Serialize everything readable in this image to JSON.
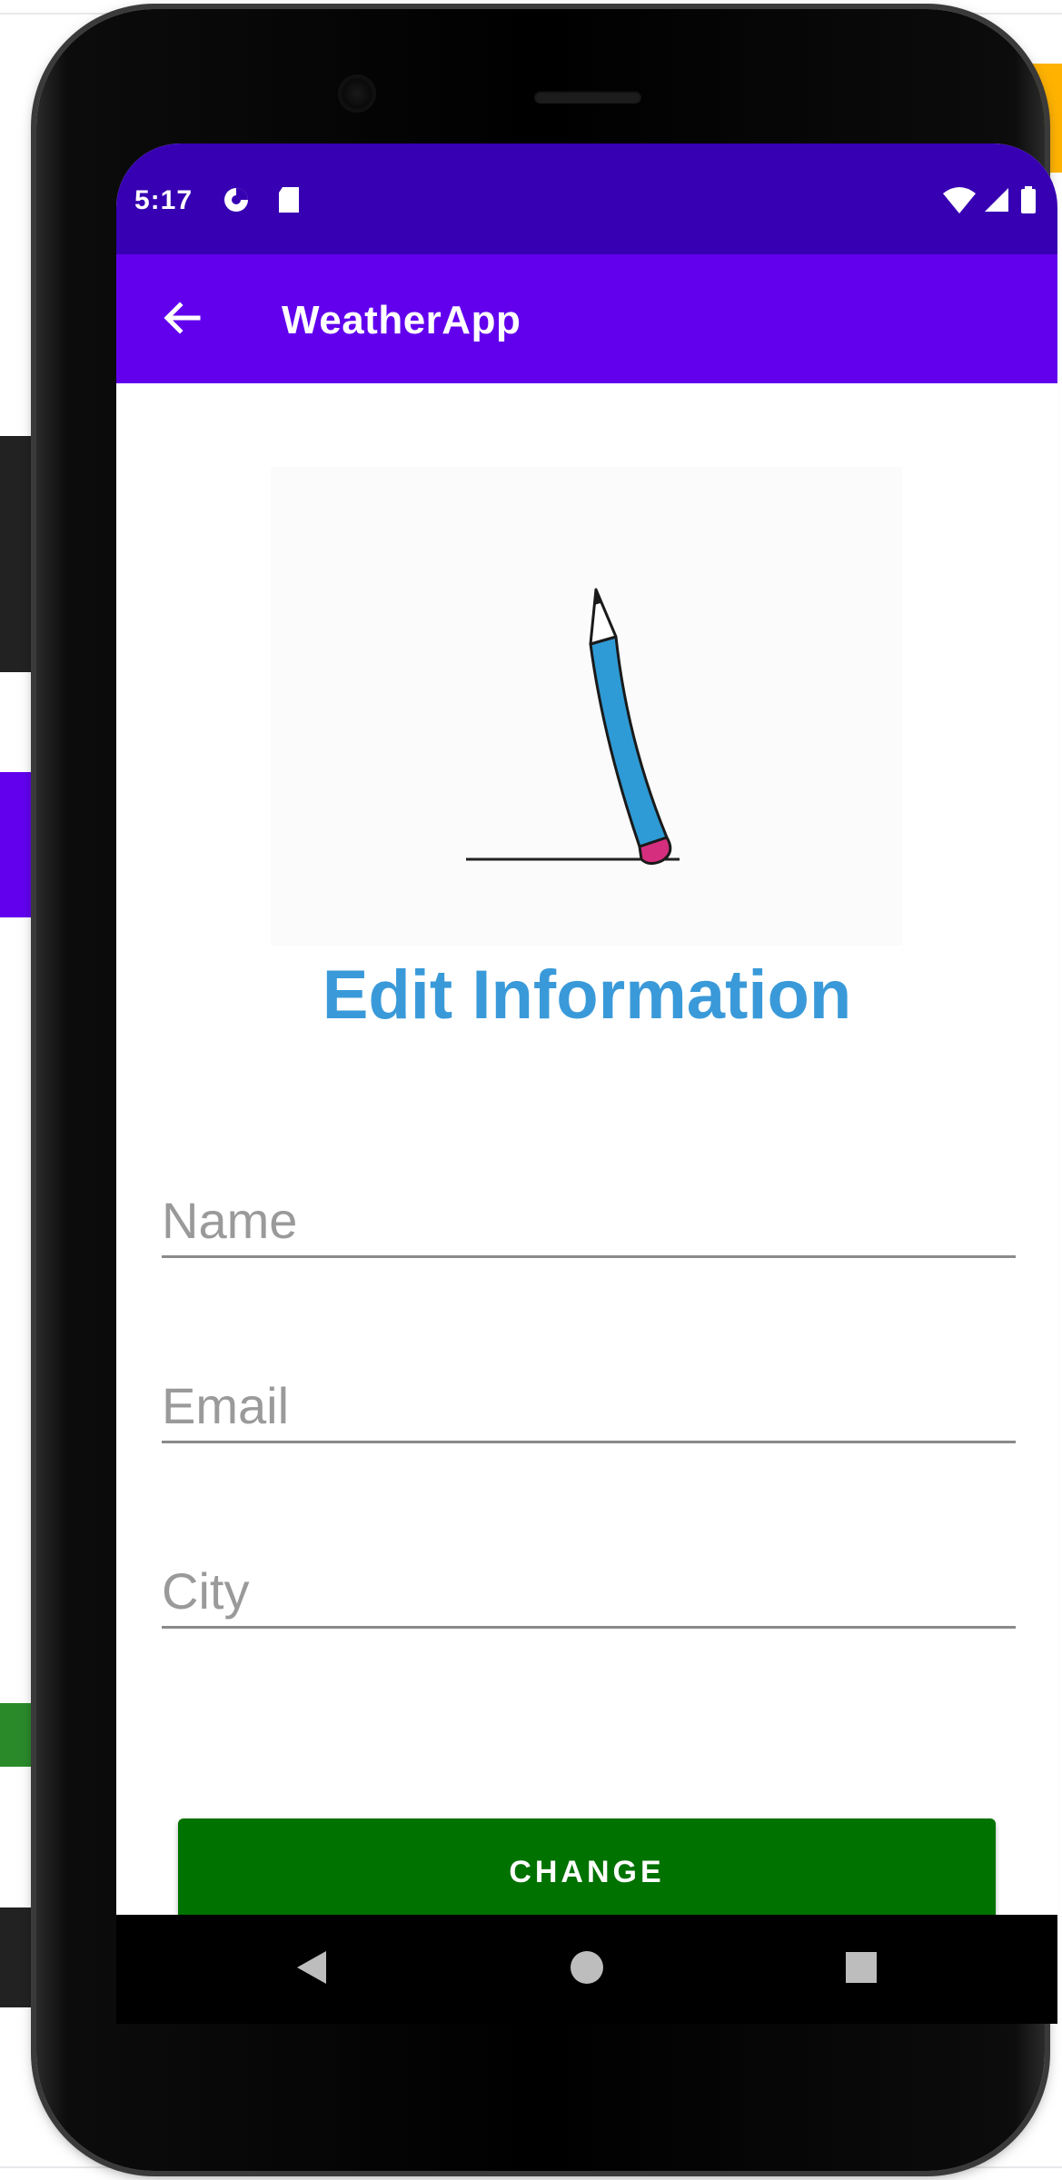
{
  "status_bar": {
    "time": "5:17",
    "icons": [
      "data-saver-icon",
      "sd-card-icon",
      "wifi-icon",
      "signal-icon",
      "battery-icon"
    ]
  },
  "app_bar": {
    "title": "WeatherApp",
    "back_icon": "arrow-back-icon"
  },
  "illustration": {
    "icon": "pencil-illustration"
  },
  "form": {
    "heading": "Edit Information",
    "fields": [
      {
        "name": "name",
        "placeholder": "Name",
        "value": ""
      },
      {
        "name": "email",
        "placeholder": "Email",
        "value": ""
      },
      {
        "name": "city",
        "placeholder": "City",
        "value": ""
      }
    ],
    "button_label": "CHANGE"
  },
  "nav_bar": {
    "buttons": [
      "back-triangle-icon",
      "home-circle-icon",
      "recents-square-icon"
    ]
  },
  "colors": {
    "status_bar": "#3700b3",
    "app_bar": "#6200ee",
    "heading": "#3a9ad9",
    "button": "#007200",
    "pencil_body": "#2e9bd6",
    "pencil_eraser": "#d62e7e"
  }
}
